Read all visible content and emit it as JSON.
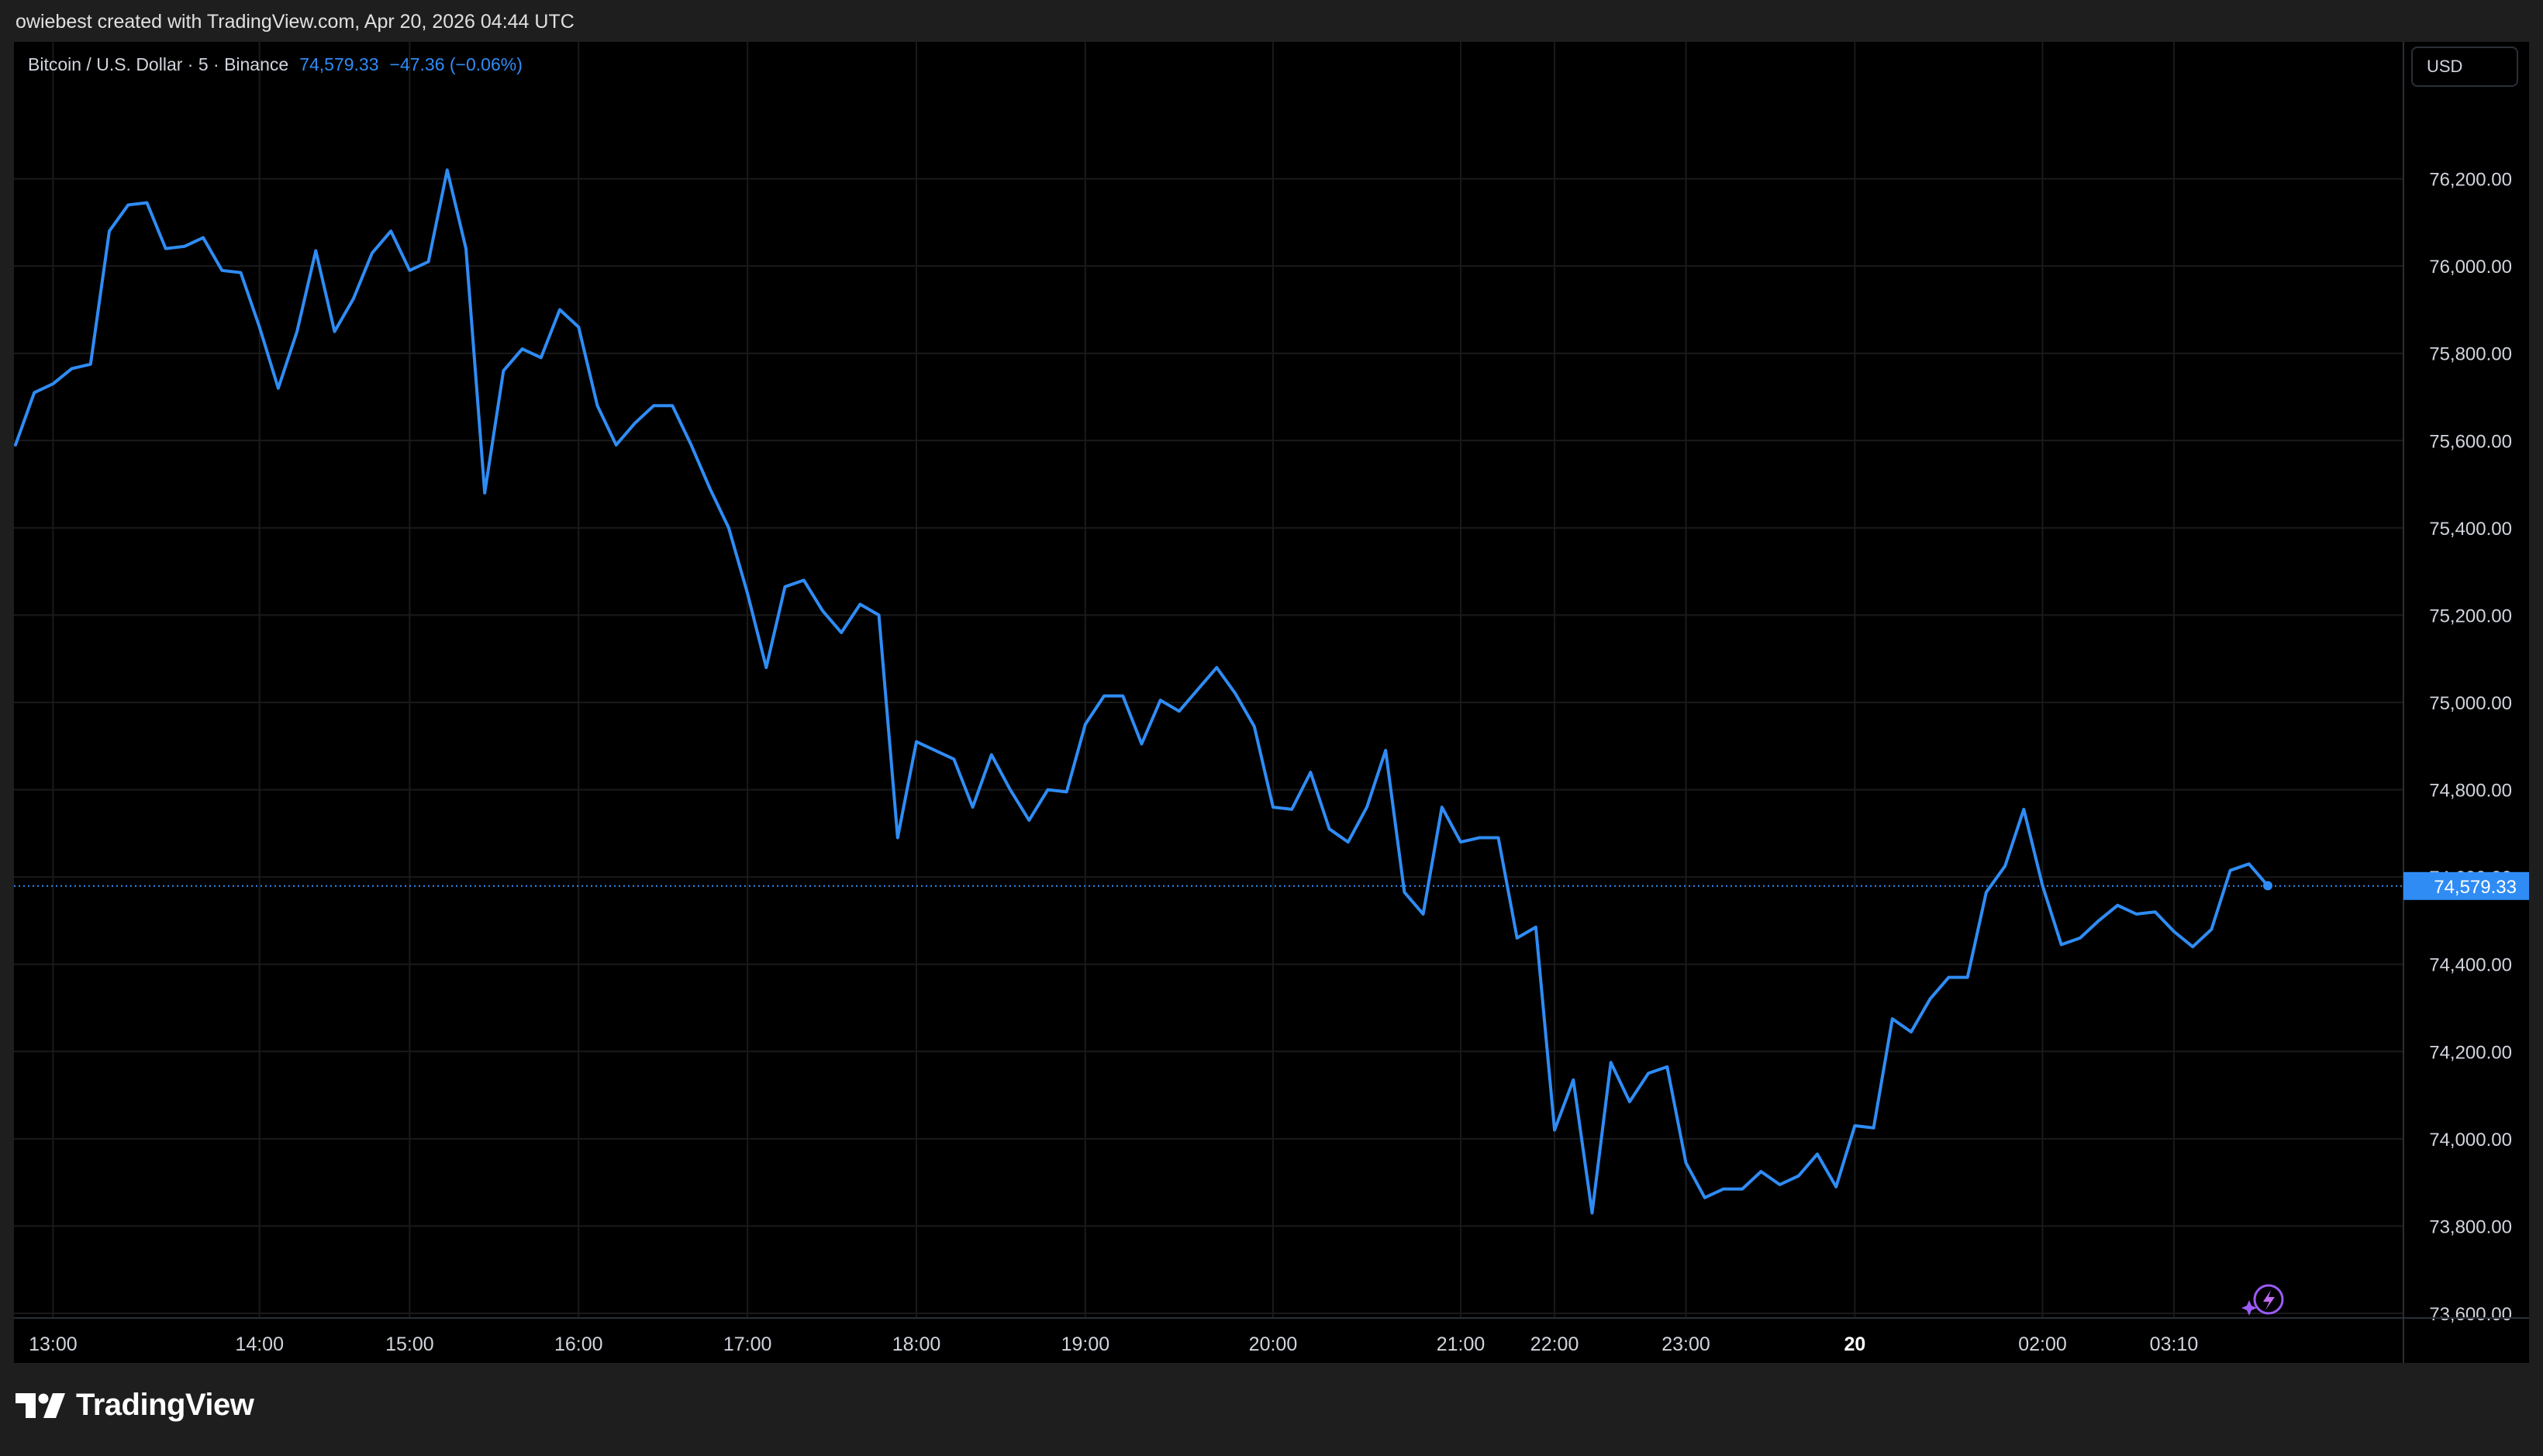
{
  "header": {
    "creator_text": "owiebest created with TradingView.com, Apr 20, 2026 04:44 UTC"
  },
  "legend": {
    "symbol": "Bitcoin / U.S. Dollar · 5 · Binance",
    "price": "74,579.33",
    "change": "−47.36 (−0.06%)"
  },
  "currency_button": "USD",
  "footer": {
    "brand": "TradingView"
  },
  "colors": {
    "line": "#2f8cf5",
    "background": "#000000",
    "grid": "#1a1a1a",
    "price_label_bg": "#2f8cf5"
  },
  "chart_data": {
    "type": "line",
    "title": "Bitcoin / U.S. Dollar · 5 · Binance",
    "ylim": [
      73600,
      76400
    ],
    "grid": true,
    "y_ticks": [
      {
        "value": 76200,
        "label": "76,200.00"
      },
      {
        "value": 76000,
        "label": "76,000.00"
      },
      {
        "value": 75800,
        "label": "75,800.00"
      },
      {
        "value": 75600,
        "label": "75,600.00"
      },
      {
        "value": 75400,
        "label": "75,400.00"
      },
      {
        "value": 75200,
        "label": "75,200.00"
      },
      {
        "value": 75000,
        "label": "75,000.00"
      },
      {
        "value": 74800,
        "label": "74,800.00"
      },
      {
        "value": 74600,
        "label": "74,600.00"
      },
      {
        "value": 74400,
        "label": "74,400.00"
      },
      {
        "value": 74200,
        "label": "74,200.00"
      },
      {
        "value": 74000,
        "label": "74,000.00"
      },
      {
        "value": 73800,
        "label": "73,800.00"
      },
      {
        "value": 73600,
        "label": "73,600.00"
      }
    ],
    "x_ticks": [
      {
        "index": 2,
        "label": "13:00"
      },
      {
        "index": 13,
        "label": "14:00"
      },
      {
        "index": 21,
        "label": "15:00"
      },
      {
        "index": 30,
        "label": "16:00"
      },
      {
        "index": 39,
        "label": "17:00"
      },
      {
        "index": 48,
        "label": "18:00"
      },
      {
        "index": 57,
        "label": "19:00"
      },
      {
        "index": 67,
        "label": "20:00"
      },
      {
        "index": 77,
        "label": "21:00"
      },
      {
        "index": 82,
        "label": "22:00"
      },
      {
        "index": 89,
        "label": "23:00"
      },
      {
        "index": 98,
        "label": "20"
      },
      {
        "index": 108,
        "label": "02:00"
      },
      {
        "index": 115,
        "label": "03:10"
      }
    ],
    "last_price": {
      "value": 74579.33,
      "label": "74,579.33"
    },
    "series": [
      {
        "values": [
          75590,
          75710,
          75730,
          75765,
          75775,
          76080,
          76140,
          76145,
          76040,
          76045,
          76065,
          75990,
          75985,
          75860,
          75720,
          75850,
          76035,
          75850,
          75925,
          76030,
          76080,
          75990,
          76010,
          76220,
          76040,
          75480,
          75760,
          75810,
          75790,
          75900,
          75860,
          75680,
          75590,
          75640,
          75680,
          75680,
          75590,
          75490,
          75400,
          75250,
          75080,
          75265,
          75280,
          75210,
          75160,
          75225,
          75200,
          74690,
          74910,
          74890,
          74870,
          74760,
          74880,
          74800,
          74730,
          74800,
          74795,
          74950,
          75015,
          75015,
          74905,
          75005,
          74980,
          75030,
          75080,
          75020,
          74945,
          74760,
          74755,
          74840,
          74710,
          74680,
          74760,
          74890,
          74565,
          74515,
          74760,
          74680,
          74690,
          74690,
          74460,
          74485,
          74020,
          74135,
          73830,
          74175,
          74085,
          74150,
          74165,
          73945,
          73865,
          73885,
          73885,
          73925,
          73895,
          73915,
          73965,
          73890,
          74030,
          74025,
          74275,
          74245,
          74320,
          74370,
          74370,
          74565,
          74625,
          74755,
          74580,
          74445,
          74460,
          74500,
          74535,
          74515,
          74520,
          74475,
          74440,
          74480,
          74615,
          74630,
          74580
        ]
      }
    ]
  }
}
